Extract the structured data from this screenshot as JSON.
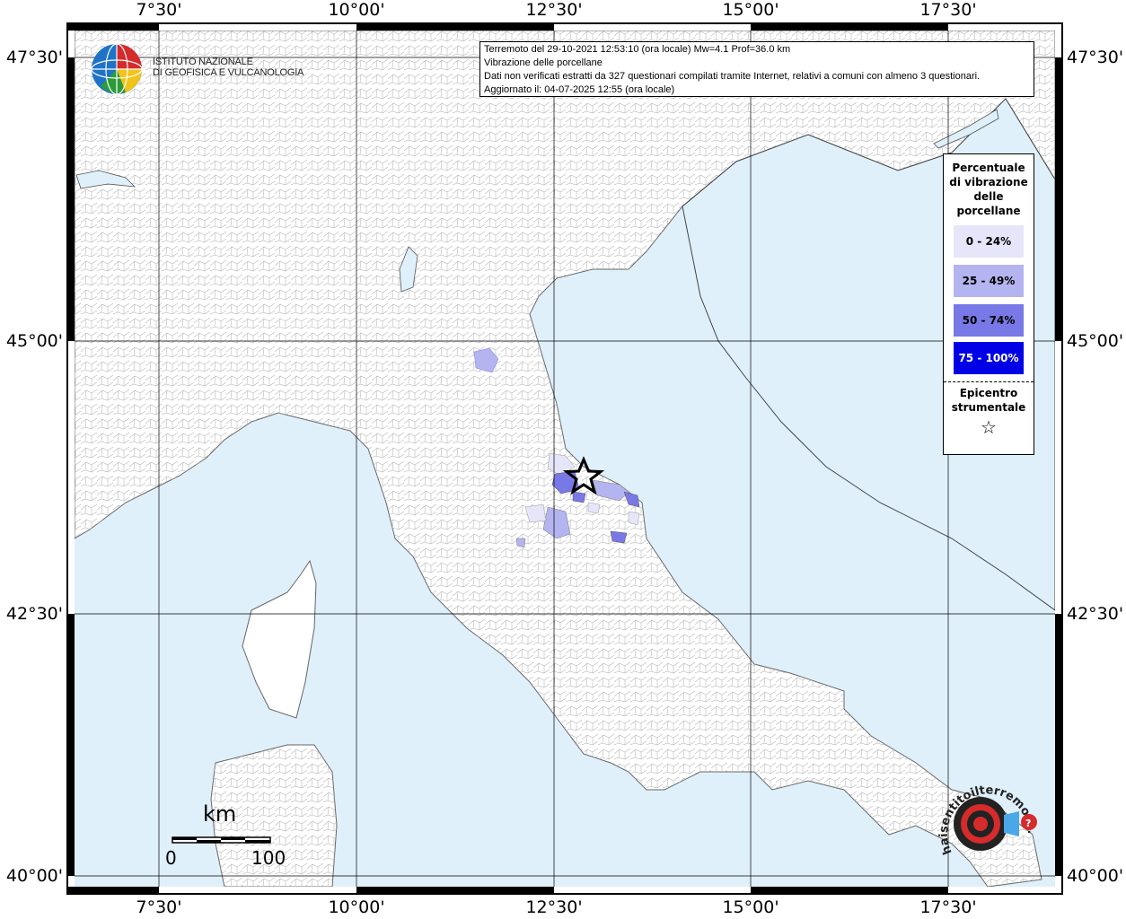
{
  "header": {
    "line1": "Terremoto del 29-10-2021 12:53:10 (ora locale) Mw=4.1 Prof=36.0 km",
    "line2": "Vibrazione delle porcellane",
    "line3": "Dati non verificati estratti da 327 questionari compilati tramite Internet, relativi a comuni con almeno 3 questionari.",
    "line4": "Aggiornato il: 04-07-2025 12:55 (ora locale)"
  },
  "logo": {
    "name": "ingv-logo",
    "line1": "ISTITUTO NAZIONALE",
    "line2": "DI GEOFISICA E VULCANOLOGIA"
  },
  "axes": {
    "longitude_labels": [
      "7°30'",
      "10°00'",
      "12°30'",
      "15°00'",
      "17°30'"
    ],
    "latitude_labels": [
      "47°30'",
      "45°00'",
      "42°30'",
      "40°00'"
    ]
  },
  "legend": {
    "title": "Percentuale di vibrazione delle porcellane",
    "classes": [
      {
        "label": "0 - 24%",
        "color": "#e6e6fa",
        "text_color": "#000000"
      },
      {
        "label": "25 - 49%",
        "color": "#b4b4f0",
        "text_color": "#000000"
      },
      {
        "label": "50 - 74%",
        "color": "#7878e6",
        "text_color": "#000000"
      },
      {
        "label": "75 - 100%",
        "color": "#0000e6",
        "text_color": "#ffffff"
      }
    ],
    "epicenter_label": "Epicentro strumentale",
    "epicenter_symbol": "☆"
  },
  "scale_bar": {
    "unit": "km",
    "start": "0",
    "end": "100"
  },
  "colors": {
    "sea": "#dff0fb",
    "land": "#ffffff",
    "border": "#888888",
    "grid": "#000000"
  },
  "epicenter": {
    "lat": 43.72,
    "lon": 12.83
  },
  "watermark": {
    "name": "haisentitoilterremoto-logo",
    "text": "haisentitoilterremoto.it"
  }
}
